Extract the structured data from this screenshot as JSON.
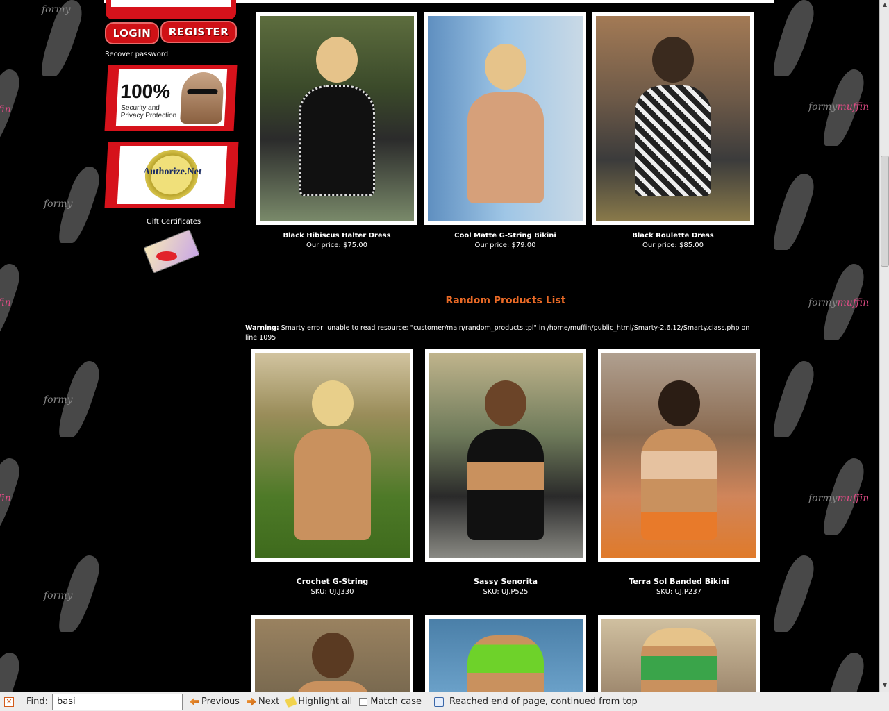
{
  "sidebar": {
    "login_label": "LOGIN",
    "register_label": "REGISTER",
    "recover_label": "Recover password",
    "security_badge": {
      "big": "100%",
      "small_line1": "Security and",
      "small_line2": "Privacy Protection"
    },
    "merchant_badge": {
      "text": "Authorize.Net"
    },
    "gift_label": "Gift Certificates"
  },
  "featured": [
    {
      "name": "Black Hibiscus Halter Dress",
      "price": "Our price: $75.00"
    },
    {
      "name": "Cool Matte G-String Bikini",
      "price": "Our price: $79.00"
    },
    {
      "name": "Black Roulette Dress",
      "price": "Our price: $85.00"
    }
  ],
  "random_section": {
    "title": "Random Products List",
    "warning_label": "Warning:",
    "warning_text": " Smarty error: unable to read resource: \"customer/main/random_products.tpl\" in /home/muffin/public_html/Smarty-2.6.12/Smarty.class.php on line 1095"
  },
  "random": [
    {
      "name": "Crochet G-String",
      "sku": "SKU: UJ.J330"
    },
    {
      "name": "Sassy Senorita",
      "sku": "SKU: UJ.P525"
    },
    {
      "name": "Terra Sol Banded Bikini",
      "sku": "SKU: UJ.P237"
    }
  ],
  "watermark": {
    "word1": "formy",
    "word2": "muffin"
  },
  "findbar": {
    "label": "Find:",
    "value": "basi",
    "previous": "Previous",
    "next": "Next",
    "highlight": "Highlight all",
    "match_case": "Match case",
    "status": "Reached end of page, continued from top"
  },
  "colors": {
    "accent_red": "#d6121b",
    "section_orange": "#ea6a26",
    "watermark_pink": "#e24c86"
  }
}
